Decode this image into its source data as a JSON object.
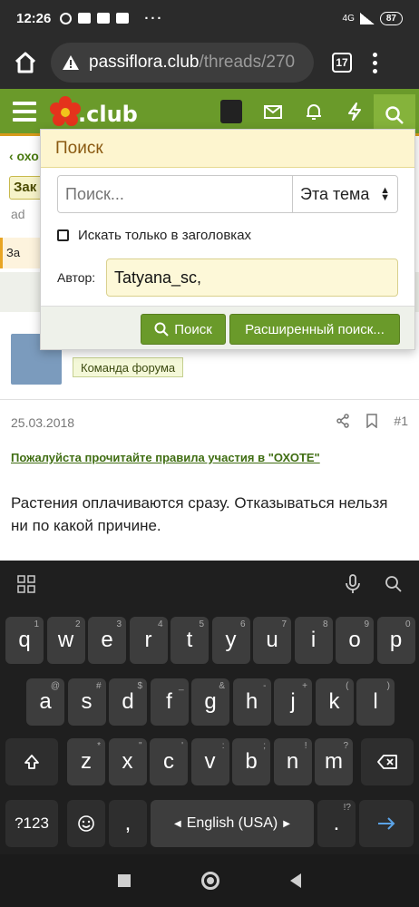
{
  "status_bar": {
    "time": "12:26",
    "network": "4G",
    "battery": "87"
  },
  "browser": {
    "url_host": "passiflora.club",
    "url_path": "/threads/270",
    "tab_count": "17"
  },
  "site": {
    "logo_text": ".club",
    "accent_color": "#6a9a2a",
    "accent_border": "#d79a1a"
  },
  "page": {
    "crumb": "‹ охо",
    "title_stub": "Зак",
    "author_stub": "ad",
    "locked_stub": "За",
    "role_badge": "Команда форума",
    "post_date": "25.03.2018",
    "post_number": "#1",
    "rules_link": "Пожалуйста прочитайте правила участия в \"ОХОТЕ\"",
    "post_body": "Растения оплачиваются сразу. Отказываться нельзя ни по какой причине."
  },
  "search_panel": {
    "title": "Поиск",
    "input_placeholder": "Поиск...",
    "scope_selected": "Эта тема",
    "titles_only_label": "Искать только в заголовках",
    "author_label": "Автор:",
    "author_value": "Tatyana_sc,",
    "search_button": "Поиск",
    "advanced_button": "Расширенный поиск..."
  },
  "keyboard": {
    "row1": [
      {
        "k": "q",
        "s": "1"
      },
      {
        "k": "w",
        "s": "2"
      },
      {
        "k": "e",
        "s": "3"
      },
      {
        "k": "r",
        "s": "4"
      },
      {
        "k": "t",
        "s": "5"
      },
      {
        "k": "y",
        "s": "6"
      },
      {
        "k": "u",
        "s": "7"
      },
      {
        "k": "i",
        "s": "8"
      },
      {
        "k": "o",
        "s": "9"
      },
      {
        "k": "p",
        "s": "0"
      }
    ],
    "row2": [
      {
        "k": "a",
        "s": "@"
      },
      {
        "k": "s",
        "s": "#"
      },
      {
        "k": "d",
        "s": "$"
      },
      {
        "k": "f",
        "s": "_"
      },
      {
        "k": "g",
        "s": "&"
      },
      {
        "k": "h",
        "s": "-"
      },
      {
        "k": "j",
        "s": "+"
      },
      {
        "k": "k",
        "s": "("
      },
      {
        "k": "l",
        "s": ")"
      }
    ],
    "row3": [
      {
        "k": "z",
        "s": "*"
      },
      {
        "k": "x",
        "s": "\""
      },
      {
        "k": "c",
        "s": "'"
      },
      {
        "k": "v",
        "s": ":"
      },
      {
        "k": "b",
        "s": ";"
      },
      {
        "k": "n",
        "s": "!"
      },
      {
        "k": "m",
        "s": "?"
      }
    ],
    "symbols_key": "?123",
    "comma_key": ",",
    "space_label": "English (USA)",
    "period_key": ".",
    "period_sub": "!?"
  }
}
